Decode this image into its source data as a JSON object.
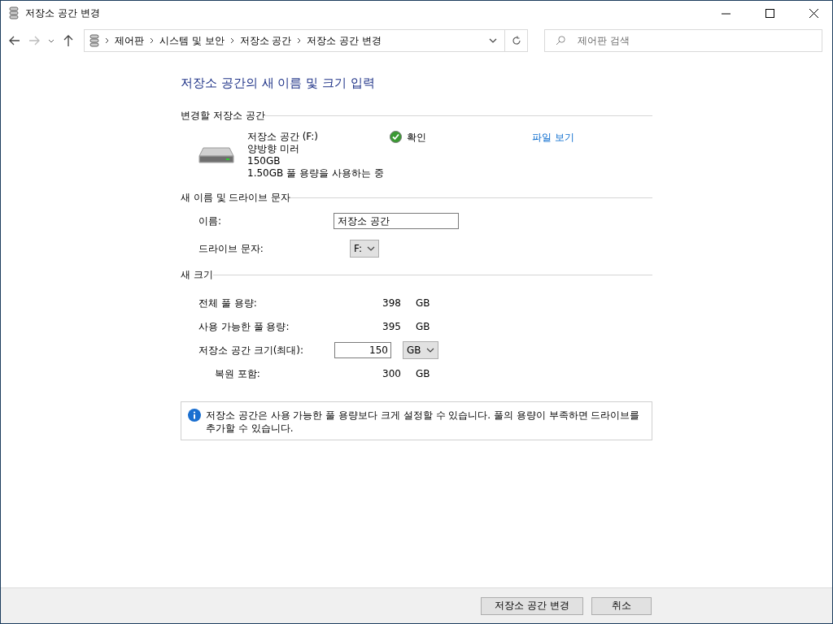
{
  "window": {
    "title": "저장소 공간 변경"
  },
  "address_bar": {
    "breadcrumbs": [
      "제어판",
      "시스템 및 보안",
      "저장소 공간",
      "저장소 공간 변경"
    ]
  },
  "search": {
    "placeholder": "제어판 검색"
  },
  "heading": "저장소 공간의 새 이름 및 크기 입력",
  "space_section": {
    "title": "변경할 저장소 공간",
    "name": "저장소 공간 (F:)",
    "resiliency": "양방향 미러",
    "size": "150GB",
    "usage": "1.50GB 풀 용량을 사용하는 중",
    "status": "확인",
    "link": "파일 보기"
  },
  "name_section": {
    "title": "새 이름 및 드라이브 문자",
    "name_label": "이름:",
    "name_value": "저장소 공간",
    "letter_label": "드라이브 문자:",
    "letter_value": "F:"
  },
  "size_section": {
    "title": "새 크기",
    "rows": [
      {
        "kind": "value",
        "label": "전체 풀 용량:",
        "value": "398",
        "unit": "GB"
      },
      {
        "kind": "value",
        "label": "사용 가능한 풀 용량:",
        "value": "395",
        "unit": "GB"
      },
      {
        "kind": "input",
        "label": "저장소 공간 크기(최대):",
        "value": "150",
        "unit": "GB"
      },
      {
        "kind": "indented",
        "label": "복원 포함:",
        "value": "300",
        "unit": "GB"
      }
    ]
  },
  "info": "저장소 공간은 사용 가능한 풀 용량보다 크게 설정할 수 있습니다. 풀의 용량이 부족하면 드라이브를 추가할 수 있습니다.",
  "buttons": [
    "저장소 공간 변경",
    "취소"
  ]
}
